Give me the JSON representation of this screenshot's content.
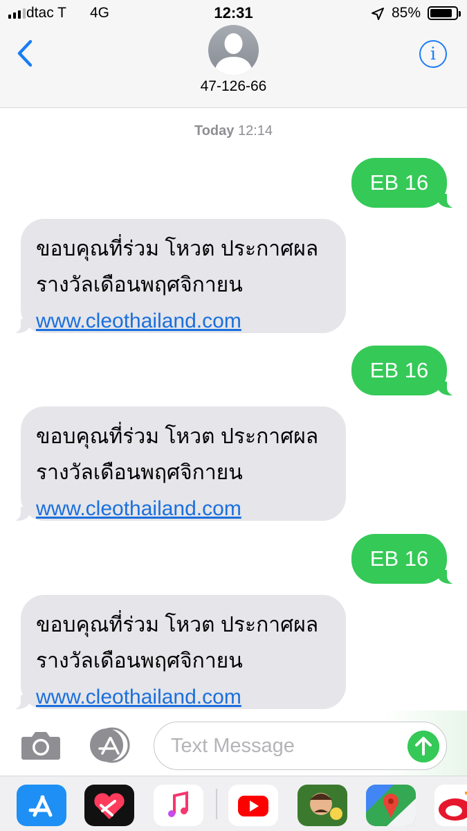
{
  "status_bar": {
    "carrier": "dtac T",
    "network": "4G",
    "time": "12:31",
    "battery_percent": "85%",
    "battery_level": 0.85,
    "signal_bars_on": 3,
    "signal_bars_total": 4
  },
  "header": {
    "contact": "47-126-66",
    "back_icon": "chevron-left-icon",
    "info_icon": "info-icon",
    "info_glyph": "i"
  },
  "conversation": {
    "timestamp_day": "Today",
    "timestamp_time": "12:14",
    "messages": [
      {
        "direction": "sent",
        "text": "EB 16"
      },
      {
        "direction": "received",
        "line1": "ขอบคุณที่ร่วม โหวต ประกาศผล",
        "line2": "รางวัลเดือนพฤศจิกายน",
        "link": "www.cleothailand.com"
      },
      {
        "direction": "sent",
        "text": "EB 16"
      },
      {
        "direction": "received",
        "line1": "ขอบคุณที่ร่วม โหวต ประกาศผล",
        "line2": "รางวัลเดือนพฤศจิกายน",
        "link": "www.cleothailand.com"
      },
      {
        "direction": "sent",
        "text": "EB 16"
      },
      {
        "direction": "received",
        "line1": "ขอบคุณที่ร่วม โหวต ประกาศผล",
        "line2": "รางวัลเดือนพฤศจิกายน",
        "link": "www.cleothailand.com"
      }
    ]
  },
  "composer": {
    "placeholder": "Text Message",
    "camera_icon": "camera-icon",
    "apps_icon": "app-store-icon",
    "send_icon": "send-arrow-icon"
  },
  "app_drawer": {
    "apps": [
      "app-store-icon",
      "digital-touch-icon",
      "music-icon",
      "youtube-icon",
      "game-character-icon",
      "google-maps-icon",
      "weibo-icon"
    ]
  },
  "colors": {
    "sent_bubble": "#35c957",
    "received_bubble": "#e5e5ea",
    "accent_blue": "#1a7cf6",
    "link": "#1a6fdc",
    "header_bg": "#f6f6f7"
  }
}
